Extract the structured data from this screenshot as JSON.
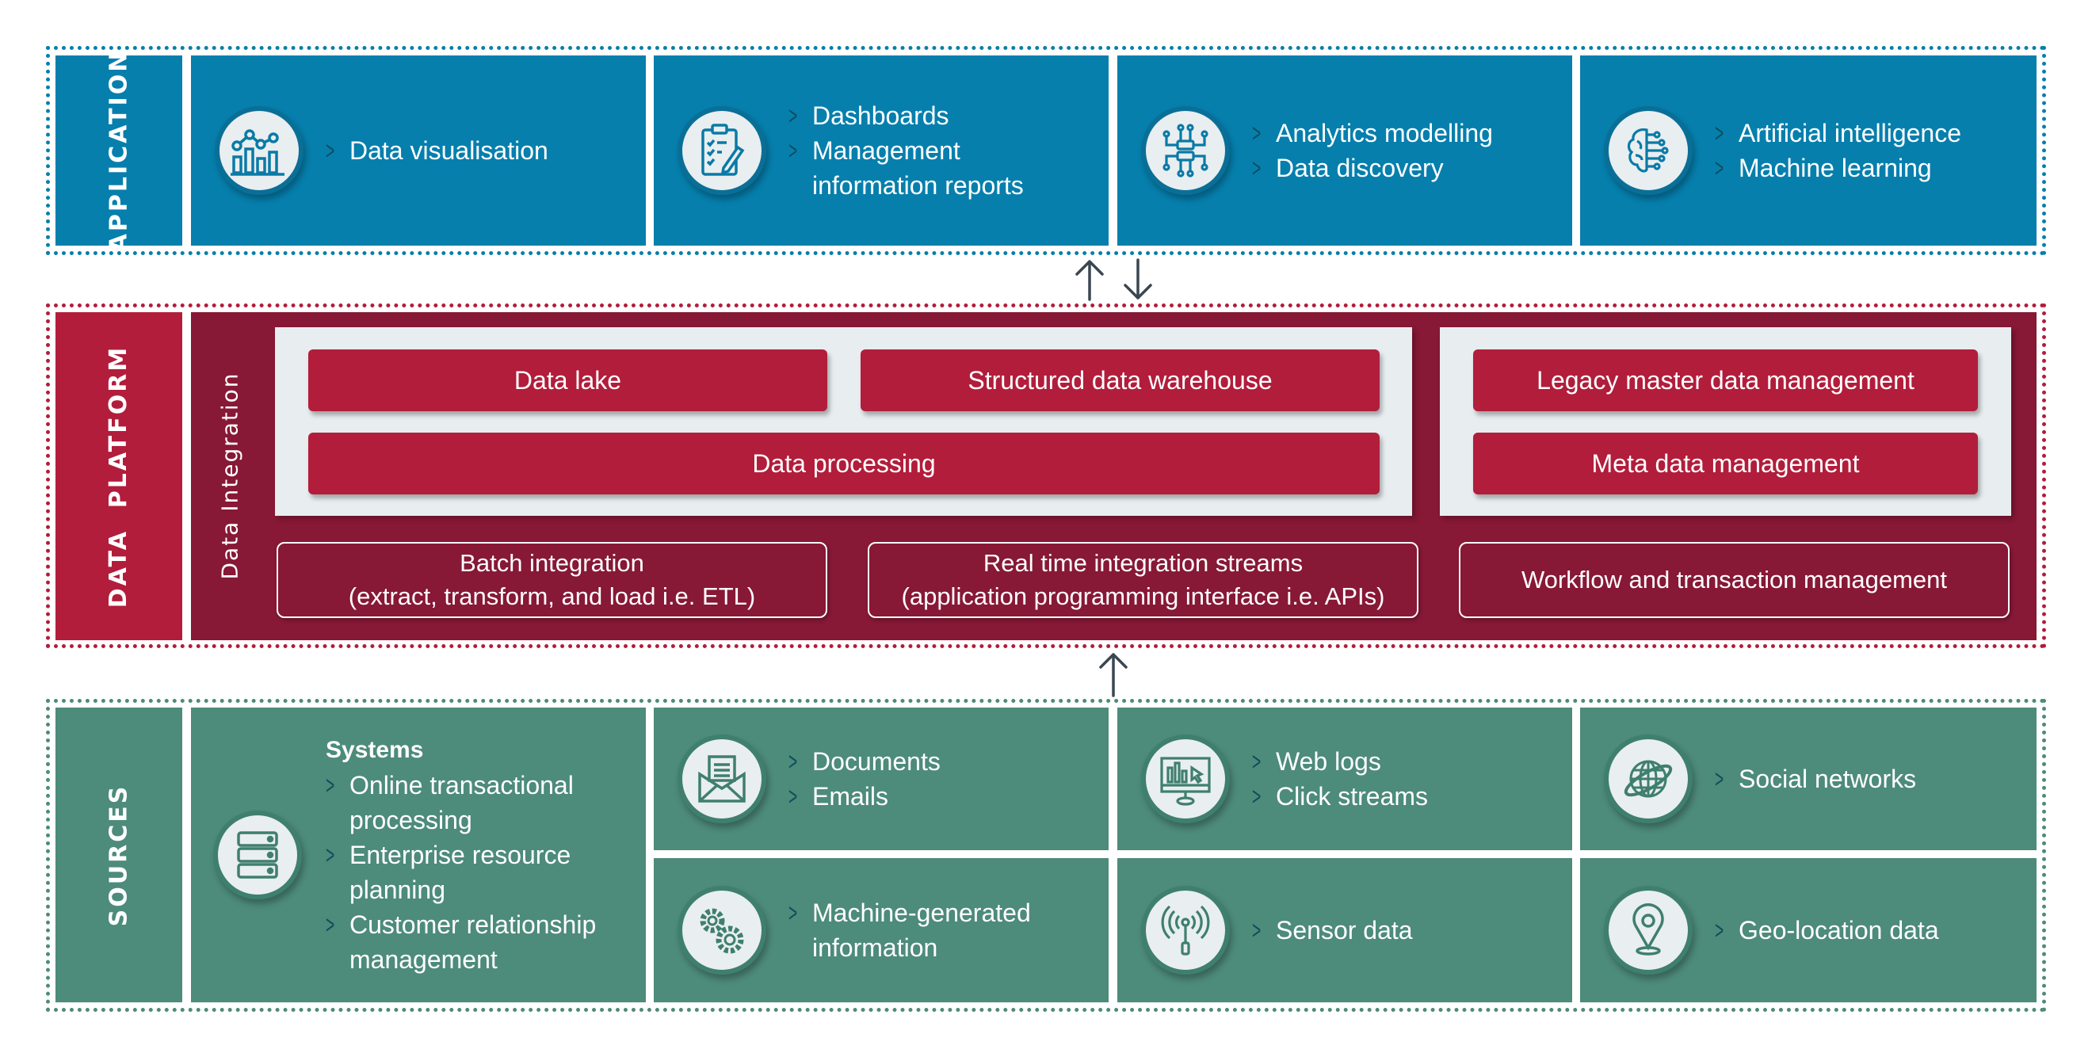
{
  "application": {
    "label": "APPLICATION",
    "panels": [
      {
        "icon": "chart-analytics-icon",
        "items": [
          "Data visualisation"
        ]
      },
      {
        "icon": "clipboard-checklist-icon",
        "items": [
          "Dashboards",
          "Management information reports"
        ]
      },
      {
        "icon": "circuit-server-icon",
        "items": [
          "Analytics modelling",
          "Data discovery"
        ]
      },
      {
        "icon": "brain-circuit-icon",
        "items": [
          "Artificial intelligence",
          "Machine learning"
        ]
      }
    ]
  },
  "data_platform": {
    "label": "DATA  PLATFORM",
    "integration_label": "Data Integration",
    "storage": {
      "data_lake": "Data lake",
      "warehouse": "Structured data warehouse",
      "processing": "Data processing"
    },
    "management": {
      "legacy_mdm": "Legacy master data management",
      "metadata": "Meta data management"
    },
    "integration": {
      "batch_title": "Batch integration",
      "batch_sub": "(extract, transform, and load i.e. ETL)",
      "realtime_title": "Real time integration streams",
      "realtime_sub": "(application programming interface i.e. APIs)",
      "workflow": "Workflow and transaction management"
    }
  },
  "sources": {
    "label": "SOURCES",
    "systems": {
      "icon": "server-stack-icon",
      "title": "Systems",
      "items": [
        "Online transactional processing",
        "Enterprise resource planning",
        "Customer relationship management"
      ]
    },
    "cells": [
      {
        "icon": "envelope-document-icon",
        "items": [
          "Documents",
          "Emails"
        ]
      },
      {
        "icon": "monitor-chart-icon",
        "items": [
          "Web logs",
          "Click streams"
        ]
      },
      {
        "icon": "globe-orbit-icon",
        "items": [
          "Social networks"
        ]
      },
      {
        "icon": "gears-icon",
        "items": [
          "Machine-generated information"
        ]
      },
      {
        "icon": "sensor-antenna-icon",
        "items": [
          "Sensor data"
        ]
      },
      {
        "icon": "location-pin-icon",
        "items": [
          "Geo-location data"
        ]
      }
    ]
  },
  "colors": {
    "application": "#067fad",
    "platform_label": "#b21d3b",
    "platform_body": "#871836",
    "sources": "#4d8b7a",
    "arrow": "#3a4750"
  }
}
